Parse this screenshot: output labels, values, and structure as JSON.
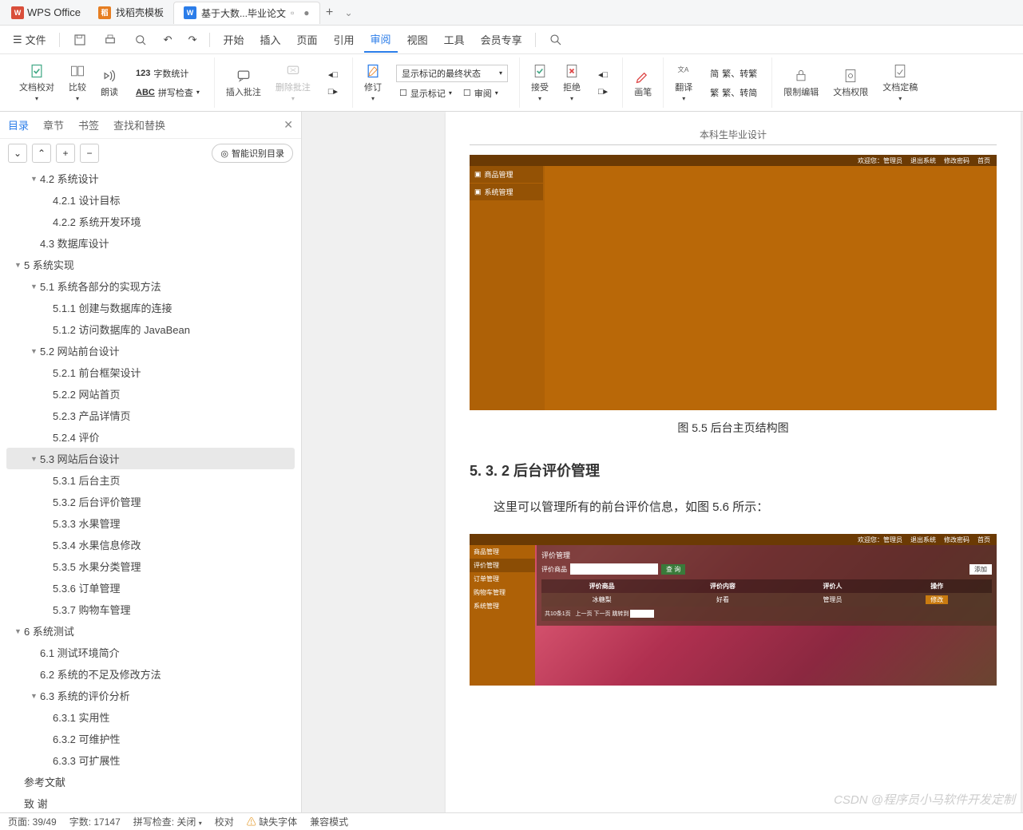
{
  "titlebar": {
    "app": "WPS Office",
    "tab1": "找稻壳模板",
    "tab2": "基于大数...毕业论文",
    "newtab": "+"
  },
  "menu": {
    "file": "文件",
    "m1": "开始",
    "m2": "插入",
    "m3": "页面",
    "m4": "引用",
    "m5": "审阅",
    "m6": "视图",
    "m7": "工具",
    "m8": "会员专享"
  },
  "ribbon": {
    "g1_check": "文档校对",
    "g1_compare": "比较",
    "g1_read": "朗读",
    "g1_wordcount": "字数统计",
    "g1_spell": "拼写检查",
    "g2_insert": "插入批注",
    "g2_delete": "删除批注",
    "g3_track": "修订",
    "g3_dropdown": "显示标记的最终状态",
    "g3_showmark": "显示标记",
    "g3_review": "审阅",
    "g4_accept": "接受",
    "g4_reject": "拒绝",
    "g5_pen": "画笔",
    "g6_trans": "翻译",
    "g6_sc": "繁、转繁",
    "g6_tc": "繁、转简",
    "g7_restrict": "限制编辑",
    "g7_perm": "文档权限",
    "g7_final": "文档定稿"
  },
  "side": {
    "tab_toc": "目录",
    "tab_chapter": "章节",
    "tab_bookmark": "书签",
    "tab_find": "查找和替换",
    "smart": "智能识别目录",
    "items": [
      {
        "lvl": 2,
        "txt": "4.2  系统设计",
        "caret": "▼"
      },
      {
        "lvl": 3,
        "txt": "4.2.1  设计目标"
      },
      {
        "lvl": 3,
        "txt": "4.2.2  系统开发环境"
      },
      {
        "lvl": 2,
        "txt": "4.3  数据库设计"
      },
      {
        "lvl": 1,
        "txt": "5   系统实现",
        "caret": "▼"
      },
      {
        "lvl": 2,
        "txt": "5.1  系统各部分的实现方法",
        "caret": "▼"
      },
      {
        "lvl": 3,
        "txt": "5.1.1  创建与数据库的连接"
      },
      {
        "lvl": 3,
        "txt": "5.1.2  访问数据库的 JavaBean"
      },
      {
        "lvl": 2,
        "txt": "5.2  网站前台设计",
        "caret": "▼"
      },
      {
        "lvl": 3,
        "txt": "5.2.1  前台框架设计"
      },
      {
        "lvl": 3,
        "txt": "5.2.2  网站首页"
      },
      {
        "lvl": 3,
        "txt": "5.2.3  产品详情页"
      },
      {
        "lvl": 3,
        "txt": "5.2.4  评价"
      },
      {
        "lvl": 2,
        "txt": "5.3 网站后台设计",
        "caret": "▼",
        "sel": true
      },
      {
        "lvl": 3,
        "txt": "5.3.1  后台主页"
      },
      {
        "lvl": 3,
        "txt": "5.3.2  后台评价管理"
      },
      {
        "lvl": 3,
        "txt": "5.3.3  水果管理"
      },
      {
        "lvl": 3,
        "txt": "5.3.4  水果信息修改"
      },
      {
        "lvl": 3,
        "txt": "5.3.5  水果分类管理"
      },
      {
        "lvl": 3,
        "txt": "5.3.6  订单管理"
      },
      {
        "lvl": 3,
        "txt": "5.3.7  购物车管理"
      },
      {
        "lvl": 1,
        "txt": "6   系统测试",
        "caret": "▼"
      },
      {
        "lvl": 2,
        "txt": "6.1  测试环境简介"
      },
      {
        "lvl": 2,
        "txt": "6.2  系统的不足及修改方法"
      },
      {
        "lvl": 2,
        "txt": "6.3  系统的评价分析",
        "caret": "▼"
      },
      {
        "lvl": 3,
        "txt": "6.3.1  实用性"
      },
      {
        "lvl": 3,
        "txt": "6.3.2  可维护性"
      },
      {
        "lvl": 3,
        "txt": "6.3.3  可扩展性"
      },
      {
        "lvl": 1,
        "txt": "参考文献"
      },
      {
        "lvl": 1,
        "txt": "致   谢"
      }
    ]
  },
  "doc": {
    "header": "本科生毕业设计",
    "img1": {
      "topnav": {
        "welcome": "欢迎您：管理员",
        "logout": "退出系统",
        "chpwd": "修改密码",
        "home": "首页"
      },
      "side": {
        "goods": "商品管理",
        "sys": "系统管理"
      }
    },
    "caption1": "图 5.5    后台主页结构图",
    "h2": "5. 3. 2  后台评价管理",
    "para": "这里可以管理所有的前台评价信息，如图 5.6 所示：",
    "img2": {
      "topnav": {
        "welcome": "欢迎您：管理员",
        "logout": "退出系统",
        "chpwd": "修改密码",
        "home": "首页"
      },
      "side": {
        "goods": "商品管理",
        "eval": "评价管理",
        "order": "订单管理",
        "cart": "购物车管理",
        "sys": "系统管理"
      },
      "title": "评价管理",
      "search_label": "评价商品",
      "search_btn": "查 询",
      "add_btn": "添加",
      "th": {
        "goods": "评价商品",
        "content": "评价内容",
        "user": "评价人",
        "op": "操作"
      },
      "row": {
        "goods": "冰糖梨",
        "content": "好看",
        "user": "管理员",
        "op": "修改"
      },
      "pager": "共10条1页 &nbsp; 上一页 下一页 跳转到"
    }
  },
  "status": {
    "page": "页面: 39/49",
    "words": "字数: 17147",
    "spell": "拼写检查: 关闭",
    "proof": "校对",
    "missfont": "缺失字体",
    "compat": "兼容模式"
  },
  "watermark": "CSDN @程序员小马软件开发定制"
}
